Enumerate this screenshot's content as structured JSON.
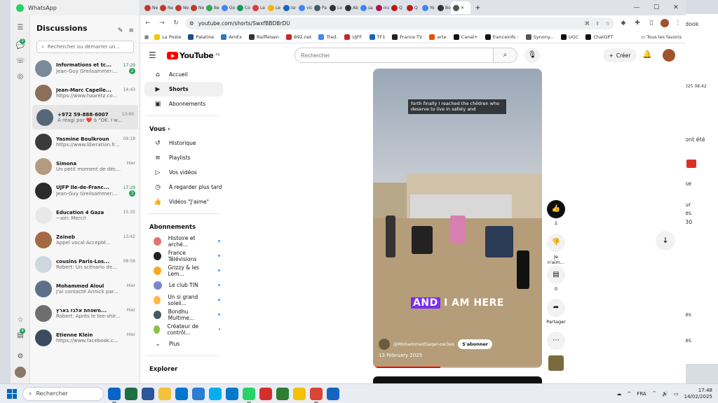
{
  "back_window": {
    "title_fragment": "dook",
    "timestamp_fragment": "025 08:42",
    "text_fragments": [
      "ont été",
      "se",
      "ur",
      "es",
      "30",
      "es",
      "es"
    ]
  },
  "whatsapp": {
    "app_title": "WhatsApp",
    "header_title": "Discussions",
    "search_placeholder": "Rechercher ou démarrer un...",
    "rail_badges": {
      "chats": "3",
      "archive": "4"
    },
    "chats": [
      {
        "name": "Informations et tc...",
        "time": "17:29",
        "message": "Jean-Guy Greilsammer:...",
        "unread": "2",
        "avatar_color": "#7a8a99"
      },
      {
        "name": "Jean-Marc Capelle...",
        "time": "14:43",
        "message": "https://www.haaretz.co...",
        "unread": "",
        "avatar_color": "#8b6f5a"
      },
      {
        "name": "+972 59-888-6007",
        "time": "13:00",
        "message": "A réagi par ❤️ à \"OK. I w...",
        "unread": "",
        "avatar_color": "#556677"
      },
      {
        "name": "Yasmine Boulkroun",
        "time": "09:19",
        "message": "https://www.liberation.fr...",
        "unread": "",
        "avatar_color": "#3a3a3a"
      },
      {
        "name": "Simona",
        "time": "Hier",
        "message": "Un petit moment de déc...",
        "unread": "",
        "avatar_color": "#b59a80"
      },
      {
        "name": "UJFP Île-de-Franc...",
        "time": "17:29",
        "message": "Jean-Guy Greilsammer:...",
        "unread": "3",
        "avatar_color": "#2b2b2b"
      },
      {
        "name": "Education 4 Gaza",
        "time": "15:35",
        "message": "~airi: Merci!",
        "unread": "",
        "avatar_color": "#e8e8e8"
      },
      {
        "name": "Zeineb",
        "time": "13:42",
        "message": "Appel vocal·Accepté...",
        "unread": "",
        "avatar_color": "#a56a43"
      },
      {
        "name": "cousins Paris-Los...",
        "time": "08:59",
        "message": "Robert: Un scénario de...",
        "unread": "",
        "avatar_color": "#cfd6dd"
      },
      {
        "name": "Mohammed Aloul",
        "time": "Hier",
        "message": "J'ai contacté Annick par...",
        "unread": "",
        "avatar_color": "#5d7089"
      },
      {
        "name": "משפחת אלבז בארץ...",
        "time": "Hier",
        "message": "Robert: Après le tee-shir...",
        "unread": "",
        "avatar_color": "#6e6e6e"
      },
      {
        "name": "Etienne Klein",
        "time": "Hier",
        "message": "https://www.facebook.c...",
        "unread": "",
        "avatar_color": "#394b5e"
      }
    ]
  },
  "chrome": {
    "tabs": [
      {
        "label": "Ne",
        "color": "#c0392b"
      },
      {
        "label": "Ne",
        "color": "#c0392b"
      },
      {
        "label": "Ne",
        "color": "#c0392b"
      },
      {
        "label": "Ne",
        "color": "#c0392b"
      },
      {
        "label": "Be",
        "color": "#34a853"
      },
      {
        "label": "Go",
        "color": "#4285f4"
      },
      {
        "label": "Co",
        "color": "#0f9d58"
      },
      {
        "label": "Le",
        "color": "#e53935"
      },
      {
        "label": "Le",
        "color": "#f4b400"
      },
      {
        "label": "Isr",
        "color": "#1565c0"
      },
      {
        "label": "vic",
        "color": "#4285f4"
      },
      {
        "label": "Pa",
        "color": "#455a64"
      },
      {
        "label": "Le",
        "color": "#333333"
      },
      {
        "label": "Ab",
        "color": "#333333"
      },
      {
        "label": "sa",
        "color": "#4285f4"
      },
      {
        "label": "ina",
        "color": "#ad1457"
      },
      {
        "label": "Q",
        "color": "#b71c1c"
      },
      {
        "label": "Q",
        "color": "#b71c1c"
      },
      {
        "label": "Yo",
        "color": "#4285f4"
      },
      {
        "label": "Bo",
        "color": "#333333"
      }
    ],
    "url": "youtube.com/shorts/SwxfBBDBrDU",
    "bookmarks": [
      {
        "label": "La Poste",
        "color": "#f5c400"
      },
      {
        "label": "Palatine",
        "color": "#1a4d8f"
      },
      {
        "label": "AmEx",
        "color": "#2e77bb"
      },
      {
        "label": "Raiffeisen",
        "color": "#333"
      },
      {
        "label": "B92.net",
        "color": "#c62828"
      },
      {
        "label": "Trad.",
        "color": "#4285f4"
      },
      {
        "label": "UJFF",
        "color": "#c62828"
      },
      {
        "label": "TF1",
        "color": "#1565c0"
      },
      {
        "label": "France TV",
        "color": "#222"
      },
      {
        "label": "arte",
        "color": "#e65100"
      },
      {
        "label": "Canal+",
        "color": "#111"
      },
      {
        "label": "franceinfo :",
        "color": "#111"
      },
      {
        "label": "Synony...",
        "color": "#555"
      },
      {
        "label": "UGC",
        "color": "#111"
      },
      {
        "label": "ChatGPT",
        "color": "#111"
      }
    ],
    "bookmarks_folder": "Tous les favoris"
  },
  "youtube": {
    "logo_text": "YouTube",
    "region": "FR",
    "search_placeholder": "Rechercher",
    "create_label": "Créer",
    "nav": [
      {
        "label": "Accueil",
        "icon": "⌂"
      },
      {
        "label": "Shorts",
        "icon": "▶"
      },
      {
        "label": "Abonnements",
        "icon": "▣"
      }
    ],
    "you_header": "Vous",
    "you_items": [
      {
        "label": "Historique",
        "icon": "↺"
      },
      {
        "label": "Playlists",
        "icon": "≡"
      },
      {
        "label": "Vos vidéos",
        "icon": "▷"
      },
      {
        "label": "À regarder plus tard",
        "icon": "◷"
      },
      {
        "label": "Vidéos \"J'aime\"",
        "icon": "👍"
      }
    ],
    "subs_header": "Abonnements",
    "subscriptions": [
      {
        "label": "Histoire et arché...",
        "color": "#e57373"
      },
      {
        "label": "France Télévisions",
        "color": "#222222"
      },
      {
        "label": "Grizzy & les Lem...",
        "color": "#f9a825"
      },
      {
        "label": "Le club TIN",
        "color": "#7986cb"
      },
      {
        "label": "Un si grand soleil...",
        "color": "#ffb74d"
      },
      {
        "label": "Bondhu Multime...",
        "color": "#455a64"
      },
      {
        "label": "Créateur de contrôl...",
        "color": "#8bc34a"
      }
    ],
    "more_label": "Plus",
    "explore_header": "Explorer",
    "video": {
      "caption": "forth finally I reached the children who deserve to live in safety and",
      "overlay_word1": "AND",
      "overlay_rest": "I AM HERE",
      "channel": "@MohammedSaqer-ow3ex",
      "subscribe": "S'abonner",
      "date": "13 February 2025",
      "progress": 0.4
    },
    "actions": {
      "like_count": "2",
      "dislike_label": "Je n'aim...",
      "comment_count": "0",
      "share_label": "Partager"
    }
  },
  "taskbar": {
    "search_placeholder": "Rechercher",
    "apps": [
      {
        "name": "outlook",
        "color": "#0a64c8"
      },
      {
        "name": "excel",
        "color": "#1d6f42"
      },
      {
        "name": "word",
        "color": "#2b579a"
      },
      {
        "name": "explorer",
        "color": "#f3c13a"
      },
      {
        "name": "dell",
        "color": "#0076ce"
      },
      {
        "name": "store",
        "color": "#2b7cd3"
      },
      {
        "name": "skype",
        "color": "#00aff0"
      },
      {
        "name": "vscode",
        "color": "#007acc"
      },
      {
        "name": "whatsapp",
        "color": "#25d366"
      },
      {
        "name": "acrobat",
        "color": "#d32f2f"
      },
      {
        "name": "app-green",
        "color": "#2e7d32"
      },
      {
        "name": "norton",
        "color": "#f2c200"
      },
      {
        "name": "chrome",
        "color": "#db4437"
      },
      {
        "name": "vpn",
        "color": "#1565c0"
      }
    ],
    "lang": "FRA",
    "time": "17:48",
    "date": "14/02/2025"
  }
}
